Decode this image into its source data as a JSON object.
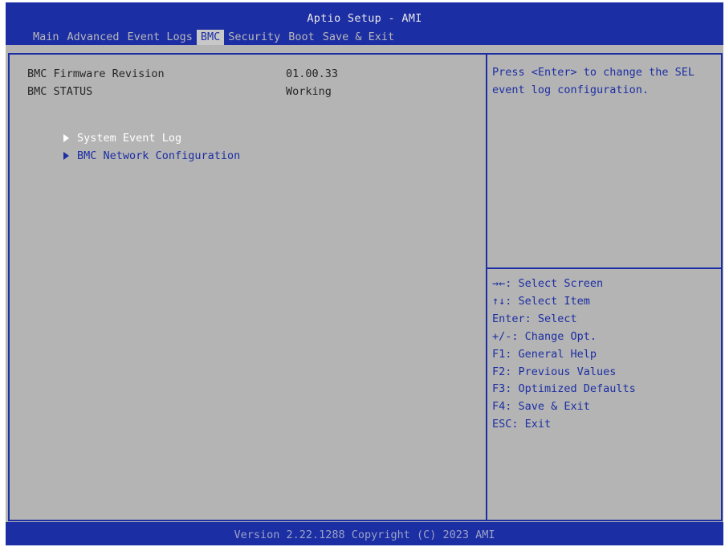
{
  "header": {
    "title": "Aptio Setup - AMI",
    "tabs": [
      {
        "label": "Main",
        "active": false
      },
      {
        "label": "Advanced",
        "active": false
      },
      {
        "label": "Event Logs",
        "active": false
      },
      {
        "label": "BMC",
        "active": true
      },
      {
        "label": "Security",
        "active": false
      },
      {
        "label": "Boot",
        "active": false
      },
      {
        "label": "Save & Exit",
        "active": false
      }
    ]
  },
  "main": {
    "rows": [
      {
        "label": "BMC Firmware Revision",
        "value": "01.00.33"
      },
      {
        "label": "BMC STATUS",
        "value": "Working"
      }
    ],
    "submenus": [
      {
        "label": "System Event Log",
        "selected": true
      },
      {
        "label": "BMC Network Configuration",
        "selected": false
      }
    ]
  },
  "help": {
    "text": "Press <Enter> to change the SEL event log configuration."
  },
  "keys": [
    "→←: Select Screen",
    "↑↓: Select Item",
    "Enter: Select",
    "+/-: Change Opt.",
    "F1: General Help",
    "F2: Previous Values",
    "F3: Optimized Defaults",
    "F4: Save & Exit",
    "ESC: Exit"
  ],
  "footer": {
    "version": "Version 2.22.1288 Copyright (C) 2023 AMI"
  },
  "colors": {
    "blue": "#1c2ea3",
    "gray_background": "#b4b4b4",
    "active_tab": "#c8c8c8",
    "selected_item": "#ffffff"
  }
}
